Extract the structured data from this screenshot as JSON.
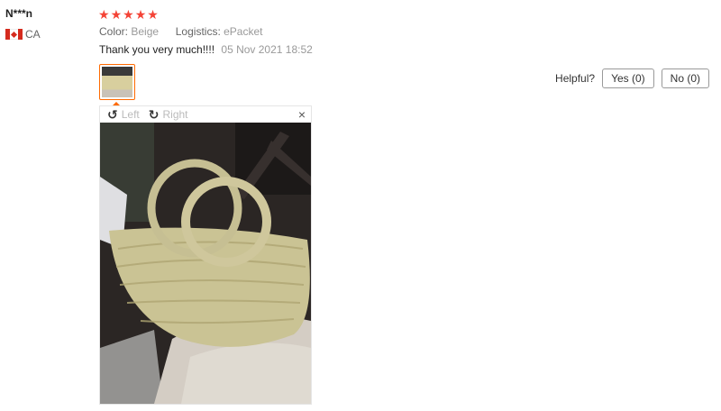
{
  "user": {
    "name": "N***n",
    "country": "CA",
    "flag_icon": "canada-flag-icon"
  },
  "rating": {
    "stars": 5,
    "max": 5,
    "star_color": "#f44336"
  },
  "attributes": [
    {
      "key": "Color:",
      "value": "Beige"
    },
    {
      "key": "Logistics:",
      "value": "ePacket"
    }
  ],
  "review": {
    "text": "Thank you very much!!!!",
    "date": "05 Nov 2021 18:52"
  },
  "viewer": {
    "left_label": "Left",
    "right_label": "Right",
    "close_glyph": "×"
  },
  "helpful": {
    "label": "Helpful?",
    "yes_label": "Yes (0)",
    "no_label": "No (0)"
  },
  "colors": {
    "accent": "#ff6a00"
  }
}
